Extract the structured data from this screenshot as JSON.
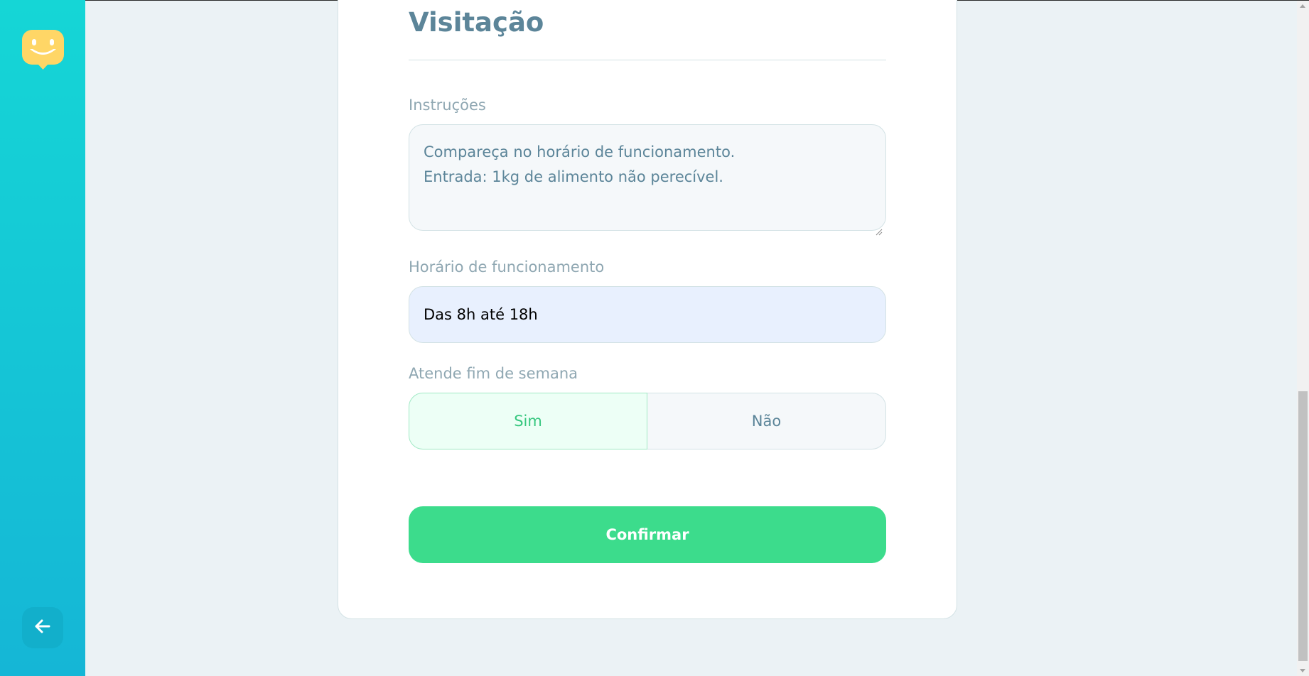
{
  "section": {
    "title": "Visitação"
  },
  "instructions": {
    "label": "Instruções",
    "lines": [
      "Compareça no horário de funcionamento.",
      "Entrada: 1kg de alimento não perecível."
    ]
  },
  "opening_hours": {
    "label": "Horário de funcionamento",
    "value": "Das 8h até 18h"
  },
  "weekends": {
    "label": "Atende fim de semana",
    "options": [
      "Sim",
      "Não"
    ],
    "selected": "Sim"
  },
  "confirm": {
    "label": "Confirmar"
  },
  "sidebar": {
    "logo_icon": "smiling-chat-bubble-icon",
    "back_icon": "arrow-left-icon"
  },
  "colors": {
    "sidebar_gradient_top": "#15D6D6",
    "sidebar_gradient_bottom": "#15B6D6",
    "logo": "#FFD666",
    "title": "#5C8599",
    "label": "#8FA7B2",
    "confirm_button": "#3CDC8C",
    "toggle_selected_text": "#37C77F",
    "page_background": "#EBF2F5"
  }
}
